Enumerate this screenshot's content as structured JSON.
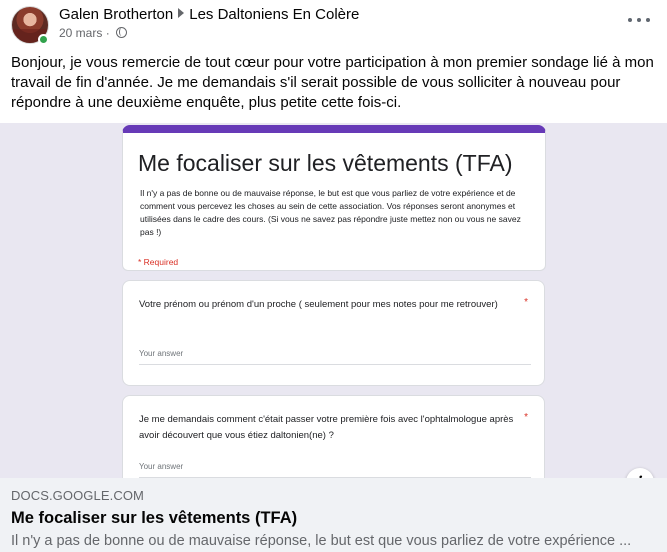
{
  "post": {
    "author": "Galen Brotherton",
    "group": "Les Daltoniens En Colère",
    "timestamp": "20 mars",
    "separator": "·",
    "privacy_icon": "globe-icon",
    "more_icon": "more-horizontal-icon",
    "text": "Bonjour, je vous remercie de tout cœur pour votre participation à mon premier sondage lié à mon travail de fin d'année. Je me demandais s'il serait possible de vous solliciter à nouveau pour répondre à une deuxième enquête, plus petite cette fois-ci."
  },
  "preview": {
    "form_title": "Me focaliser sur les vêtements (TFA)",
    "form_description": "Il n'y a pas de bonne ou de mauvaise réponse, le but est que vous parliez de votre expérience et de comment vous percevez les choses au sein de cette association. Vos réponses seront anonymes et utilisées dans le cadre des cours. (Si vous ne savez pas répondre juste mettez non ou vous ne savez pas !)",
    "required_note": "* Required",
    "questions": [
      {
        "text": "Votre prénom ou prénom d'un proche ( seulement pour mes notes pour me retrouver)",
        "required_mark": "*",
        "answer_placeholder": "Your answer"
      },
      {
        "text": "Je me demandais comment c'était passer votre première fois avec l'ophtalmologue après avoir découvert que vous étiez daltonien(ne) ?",
        "required_mark": "*",
        "answer_placeholder": "Your answer"
      }
    ],
    "accent_color": "#673ab7",
    "background_color": "#e9e7f1"
  },
  "link": {
    "info_icon": "i",
    "domain": "DOCS.GOOGLE.COM",
    "title": "Me focaliser sur les vêtements (TFA)",
    "description": "Il n'y a pas de bonne ou de mauvaise réponse, le but est que vous parliez de votre expérience ..."
  }
}
